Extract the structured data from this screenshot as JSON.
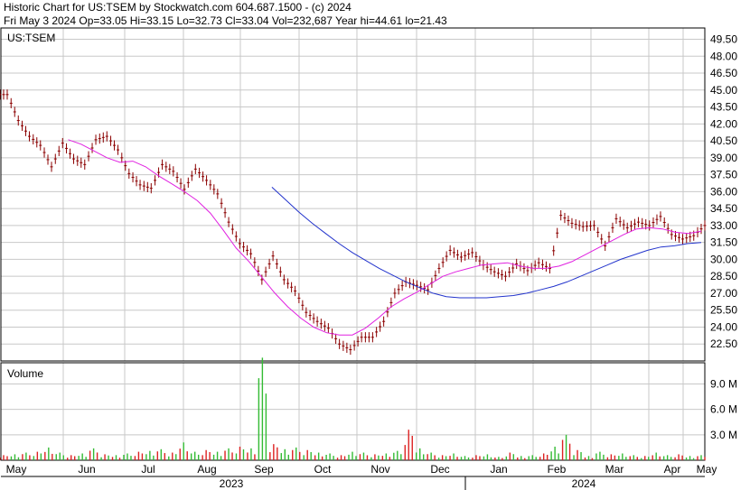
{
  "header": {
    "line1": "Historic Chart for US:TSEM by Stockwatch.com 604.687.1500 - (c) 2024",
    "line2": "Fri May  3 2024   Op=33.05   Hi=33.15   Lo=32.73   Cl=33.04   Vol=232,687   Year hi=44.61   lo=21.43"
  },
  "chart_data": {
    "type": "line",
    "title": "Historic Chart for US:TSEM by Stockwatch.com 604.687.1500 - (c) 2024",
    "symbol_label": "US:TSEM",
    "volume_label": "Volume",
    "price_ticks": [
      "49.50",
      "48.00",
      "46.50",
      "45.00",
      "43.50",
      "42.00",
      "40.50",
      "39.00",
      "37.50",
      "36.00",
      "34.50",
      "33.00",
      "31.50",
      "30.00",
      "28.50",
      "27.00",
      "25.50",
      "24.00",
      "22.50"
    ],
    "price_ylim": [
      21.0,
      50.5
    ],
    "volume_ticks": [
      "9.0 M",
      "6.0 M",
      "3.0 M"
    ],
    "volume_ylim": [
      0,
      11.5
    ],
    "months": [
      "May",
      "Jun",
      "Jul",
      "Aug",
      "Sep",
      "Oct",
      "Nov",
      "Dec",
      "Jan",
      "Feb",
      "Mar",
      "Apr",
      "May"
    ],
    "years": [
      "2023",
      "2024"
    ],
    "grid": true,
    "series": [
      {
        "key": "price",
        "values": [
          44.6,
          42.3,
          40.9,
          40.1,
          38.2,
          40.3,
          38.9,
          38.4,
          40.6,
          40.9,
          39.7,
          37.6,
          36.6,
          36.3,
          38.4,
          37.8,
          36.2,
          38.0,
          37.0,
          35.8,
          33.3,
          31.4,
          30.5,
          28.2,
          30.3,
          28.2,
          27.2,
          25.3,
          24.5,
          23.9,
          22.5,
          22.0,
          23.1,
          23.1,
          24.5,
          27.0,
          28.0,
          27.7,
          27.3,
          29.2,
          30.8,
          30.2,
          30.6,
          29.5,
          28.9,
          28.5,
          29.6,
          29.0,
          29.7,
          29.2,
          33.9,
          33.2,
          32.9,
          33.0,
          31.2,
          33.6,
          32.8,
          33.3,
          33.0,
          33.8,
          32.2,
          31.8,
          32.1,
          33.0
        ]
      },
      {
        "key": "ma_short",
        "values": [
          null,
          null,
          null,
          null,
          null,
          40.6,
          40.2,
          39.6,
          39.0,
          38.6,
          38.7,
          38.2,
          37.4,
          36.7,
          36.0,
          35.2,
          34.1,
          32.6,
          31.0,
          29.8,
          28.4,
          27.0,
          25.8,
          24.8,
          24.0,
          23.5,
          23.3,
          23.3,
          23.9,
          24.8,
          25.8,
          26.5,
          27.1,
          27.8,
          28.5,
          28.9,
          29.2,
          29.5,
          29.6,
          29.7,
          29.4,
          29.2,
          29.2,
          29.4,
          29.8,
          30.4,
          31.0,
          31.6,
          32.2,
          32.7,
          32.8,
          32.7,
          32.4,
          32.3,
          32.5
        ]
      },
      {
        "key": "ma_long",
        "values": [
          null,
          null,
          null,
          null,
          null,
          null,
          null,
          null,
          null,
          null,
          null,
          null,
          null,
          null,
          null,
          null,
          null,
          null,
          null,
          null,
          36.4,
          35.3,
          34.2,
          33.2,
          32.3,
          31.4,
          30.6,
          29.9,
          29.2,
          28.6,
          28.0,
          27.5,
          27.0,
          26.7,
          26.6,
          26.6,
          26.6,
          26.7,
          26.8,
          27.0,
          27.3,
          27.6,
          28.0,
          28.5,
          29.0,
          29.5,
          30.0,
          30.4,
          30.8,
          31.1,
          31.2,
          31.4,
          31.5
        ]
      },
      {
        "key": "volume",
        "values": [
          0.6,
          0.7,
          0.9,
          1.0,
          1.5,
          0.9,
          0.6,
          0.8,
          1.4,
          0.7,
          0.6,
          0.8,
          1.0,
          1.1,
          1.3,
          0.9,
          2.1,
          1.0,
          1.2,
          1.0,
          1.4,
          1.6,
          1.4,
          12.1,
          1.9,
          1.3,
          1.5,
          1.2,
          0.9,
          0.8,
          0.6,
          1.0,
          0.9,
          0.7,
          0.8,
          1.1,
          3.6,
          1.4,
          0.9,
          0.6,
          0.8,
          0.5,
          0.6,
          0.7,
          0.4,
          0.9,
          0.5,
          0.6,
          0.8,
          1.6,
          3.0,
          1.2,
          0.5,
          1.0,
          0.7,
          0.8,
          0.6,
          0.5,
          0.9,
          0.6,
          0.7,
          0.5,
          0.6
        ]
      }
    ]
  },
  "colors": {
    "price_bar": "#8b0000",
    "ma_short": "#e020e0",
    "ma_long": "#2233cc",
    "volume_up": "#33bb33",
    "volume_down": "#dd2222",
    "grid": "#c8c8c8",
    "panel_border": "#000000"
  }
}
